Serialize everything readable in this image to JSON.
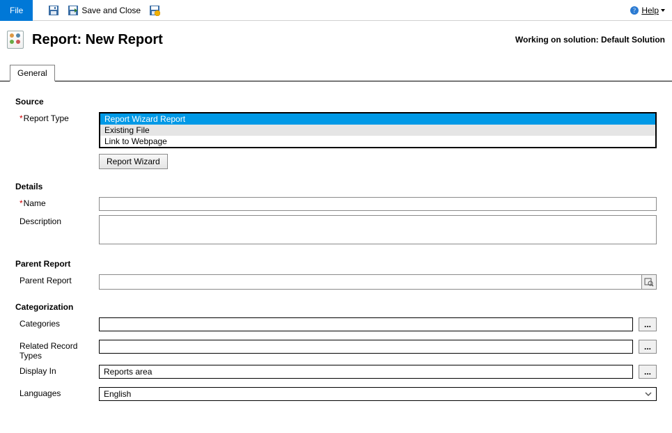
{
  "toolbar": {
    "file_label": "File",
    "save_and_close_label": "Save and Close",
    "help_label": "Help"
  },
  "header": {
    "title": "Report: New Report",
    "solution_text": "Working on solution: Default Solution"
  },
  "tabs": {
    "general": "General"
  },
  "source": {
    "section_title": "Source",
    "report_type_label": "Report Type",
    "options": [
      "Report Wizard Report",
      "Existing File",
      "Link to Webpage"
    ],
    "report_wizard_button": "Report Wizard"
  },
  "details": {
    "section_title": "Details",
    "name_label": "Name",
    "name_value": "",
    "description_label": "Description",
    "description_value": ""
  },
  "parent": {
    "section_title": "Parent Report",
    "label": "Parent Report",
    "value": ""
  },
  "categorization": {
    "section_title": "Categorization",
    "categories_label": "Categories",
    "categories_value": "",
    "related_label": "Related Record Types",
    "related_value": "",
    "display_in_label": "Display In",
    "display_in_value": "Reports area",
    "languages_label": "Languages",
    "languages_value": "English",
    "ellipsis": "..."
  }
}
